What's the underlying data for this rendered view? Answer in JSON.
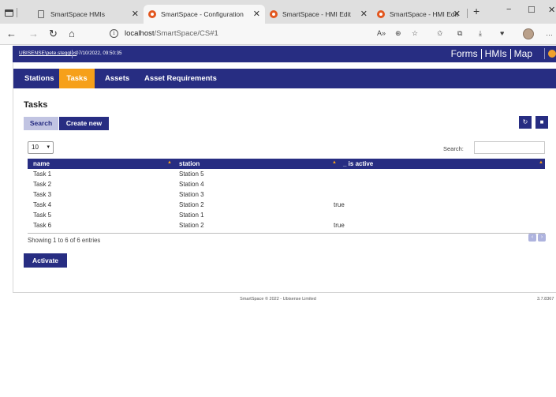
{
  "browser": {
    "tabs": [
      {
        "title": "SmartSpace HMIs",
        "active": false,
        "icon": "page-icon"
      },
      {
        "title": "SmartSpace - Configuration",
        "active": true,
        "icon": "smartspace-icon"
      },
      {
        "title": "SmartSpace - HMI Edit",
        "active": false,
        "icon": "smartspace-icon"
      },
      {
        "title": "SmartSpace - HMI Edit",
        "active": false,
        "icon": "smartspace-icon"
      }
    ],
    "url_host": "localhost",
    "url_path": "/SmartSpace/CS#1",
    "window_controls": {
      "minimize": "−",
      "maximize": "☐",
      "close": "✕"
    }
  },
  "app": {
    "user": "UBISENSE\\pete.steggles",
    "datetime": "07/10/2022, 09:50:35",
    "menu": [
      "Forms",
      "HMIs",
      "Map"
    ],
    "nav": [
      "Stations",
      "Tasks",
      "Assets",
      "Asset Requirements"
    ],
    "active_nav": "Tasks",
    "accent_color": "#272d82",
    "highlight_color": "#f6a01a"
  },
  "page": {
    "title": "Tasks",
    "search_button": "Search",
    "create_button": "Create new",
    "refresh_icon": "refresh-icon",
    "save_icon": "save-icon",
    "page_length": "10",
    "search_label": "Search:",
    "search_value": "",
    "columns": [
      "name",
      "station",
      "_ is active"
    ],
    "rows": [
      [
        "Task 1",
        "Station 5",
        ""
      ],
      [
        "Task 2",
        "Station 4",
        ""
      ],
      [
        "Task 3",
        "Station 3",
        ""
      ],
      [
        "Task 4",
        "Station 2",
        "true"
      ],
      [
        "Task 5",
        "Station 1",
        ""
      ],
      [
        "Task 6",
        "Station 2",
        "true"
      ]
    ],
    "info": "Showing 1 to 6 of 6 entries",
    "activate_button": "Activate"
  },
  "footer": {
    "copyright": "SmartSpace © 2022 - Ubisense Limited",
    "version": "3.7.8367"
  }
}
